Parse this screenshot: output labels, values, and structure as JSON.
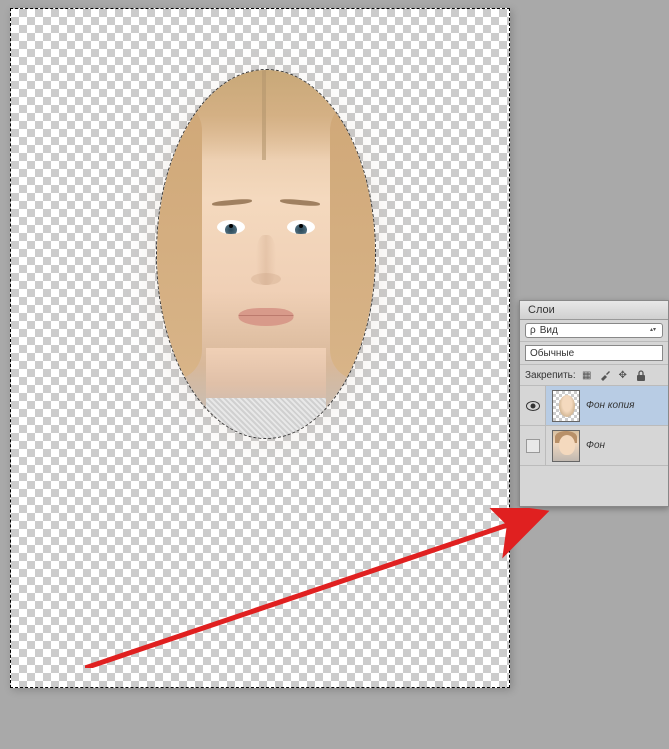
{
  "panel": {
    "title": "Слои",
    "view_label": "Вид",
    "blend_mode": "Обычные",
    "lock_label": "Закрепить:",
    "layers": [
      {
        "name": "Фон копия",
        "visible": true,
        "selected": true
      },
      {
        "name": "Фон",
        "visible": false,
        "selected": false
      }
    ]
  },
  "icons": {
    "eye": "eye-icon",
    "lock_pixels": "checkerboard-icon",
    "lock_brush": "brush-icon",
    "lock_move": "move-icon",
    "lock_all": "lock-icon"
  }
}
